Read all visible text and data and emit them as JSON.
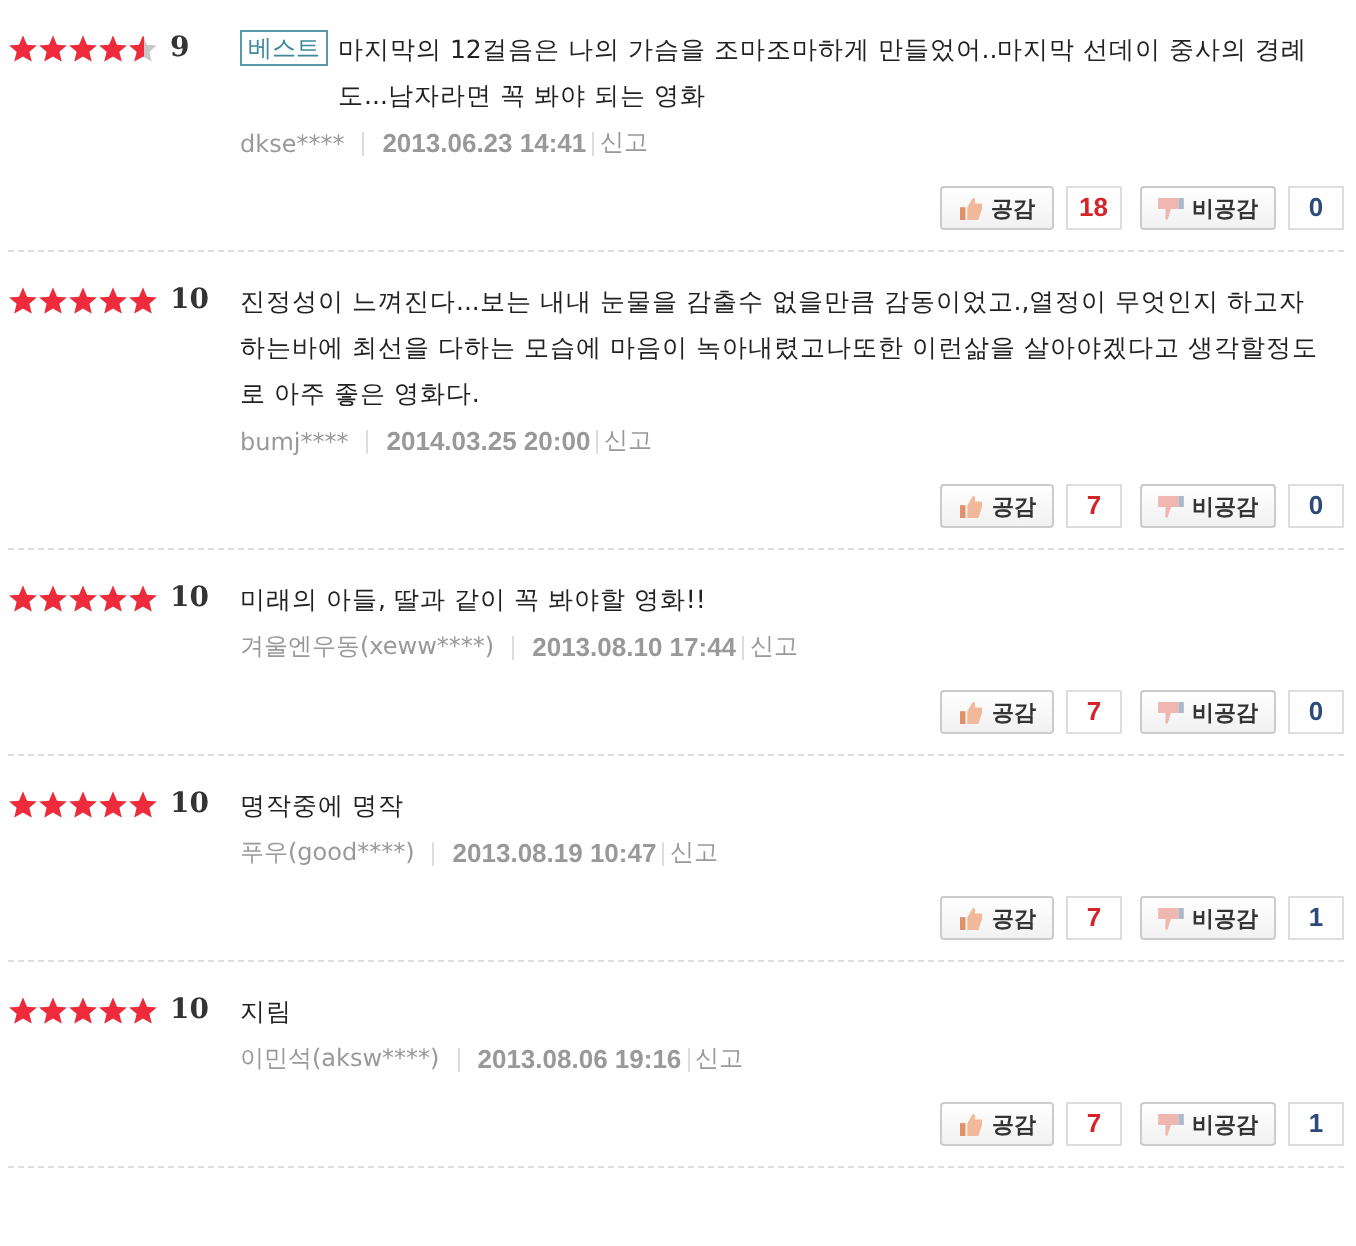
{
  "reviews": [
    {
      "stars": 4.5,
      "score": "9",
      "badge": "베스트",
      "text": "마지막의 12걸음은 나의 가슴을 조마조마하게 만들었어..마지막 선데이 중사의 경례도...남자라면 꼭 봐야 되는 영화",
      "author": "dkse****",
      "date": "2013.06.23 14:41",
      "report": "신고",
      "like_label": "공감",
      "likes": "18",
      "dislike_label": "비공감",
      "dislikes": "0"
    },
    {
      "stars": 5,
      "score": "10",
      "text": "진정성이 느껴진다...보는 내내 눈물을 감출수 없을만큼 감동이었고.,열정이 무엇인지 하고자하는바에 최선을 다하는 모습에 마음이 녹아내렸고나또한 이런삶을 살아야겠다고 생각할정도로 아주 좋은 영화다.",
      "author": "bumj****",
      "date": "2014.03.25 20:00",
      "report": "신고",
      "like_label": "공감",
      "likes": "7",
      "dislike_label": "비공감",
      "dislikes": "0"
    },
    {
      "stars": 5,
      "score": "10",
      "text": "미래의 아들, 딸과 같이 꼭 봐야할 영화!!",
      "author": "겨울엔우동(xeww****)",
      "date": "2013.08.10 17:44",
      "report": "신고",
      "like_label": "공감",
      "likes": "7",
      "dislike_label": "비공감",
      "dislikes": "0"
    },
    {
      "stars": 5,
      "score": "10",
      "text": "명작중에 명작",
      "author": "푸우(good****)",
      "date": "2013.08.19 10:47",
      "report": "신고",
      "like_label": "공감",
      "likes": "7",
      "dislike_label": "비공감",
      "dislikes": "1"
    },
    {
      "stars": 5,
      "score": "10",
      "text": "지림",
      "author": "이민석(aksw****)",
      "date": "2013.08.06 19:16",
      "report": "신고",
      "like_label": "공감",
      "likes": "7",
      "dislike_label": "비공감",
      "dislikes": "1"
    }
  ]
}
